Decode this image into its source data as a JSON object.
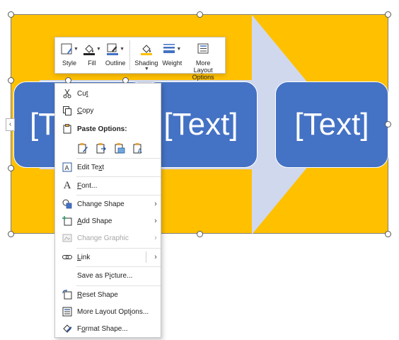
{
  "colors": {
    "background": "#FFC000",
    "arrow": "#D0D8EE",
    "text_box": "#4472C4",
    "text_box_text": "#FFFFFF",
    "menu_disabled": "#A6A6A6"
  },
  "smartart": {
    "boxes": [
      {
        "text": "[Text]"
      },
      {
        "text": "[Text]"
      },
      {
        "text": "[Text]"
      }
    ],
    "side_tab_glyph": "‹"
  },
  "mini_toolbar": {
    "style": {
      "label": "Style",
      "icon": "shape-style-icon"
    },
    "fill": {
      "label": "Fill",
      "icon": "paint-bucket-icon"
    },
    "outline": {
      "label": "Outline",
      "icon": "pen-outline-icon"
    },
    "shading": {
      "label": "Shading",
      "icon": "shading-icon"
    },
    "weight": {
      "label": "Weight",
      "icon": "line-weight-icon"
    },
    "more_layout": {
      "label_line1": "More Layout",
      "label_line2": "Options",
      "icon": "layout-options-icon"
    }
  },
  "context_menu": {
    "cut": {
      "pre": "Cu",
      "accel": "t",
      "post": ""
    },
    "copy": {
      "pre": "",
      "accel": "C",
      "post": "opy"
    },
    "paste_options": {
      "label": "Paste Options:"
    },
    "edit_text": {
      "pre": "Edit Te",
      "accel": "x",
      "post": "t"
    },
    "font": {
      "pre": "",
      "accel": "F",
      "post": "ont..."
    },
    "change_shape": {
      "pre": "Chan",
      "accel": "g",
      "post": "e Shape"
    },
    "add_shape": {
      "pre": "",
      "accel": "A",
      "post": "dd Shape"
    },
    "change_graphic": {
      "label": "Change Graphic"
    },
    "link": {
      "pre": "",
      "accel": "L",
      "post": "ink"
    },
    "save_as_picture": {
      "pre": "Save as P",
      "accel": "i",
      "post": "cture..."
    },
    "reset_shape": {
      "pre": "",
      "accel": "R",
      "post": "eset Shape"
    },
    "more_layout_options": {
      "pre": "More Layout Opt",
      "accel": "i",
      "post": "ons..."
    },
    "format_shape": {
      "pre": "F",
      "accel": "o",
      "post": "rmat Shape..."
    }
  }
}
